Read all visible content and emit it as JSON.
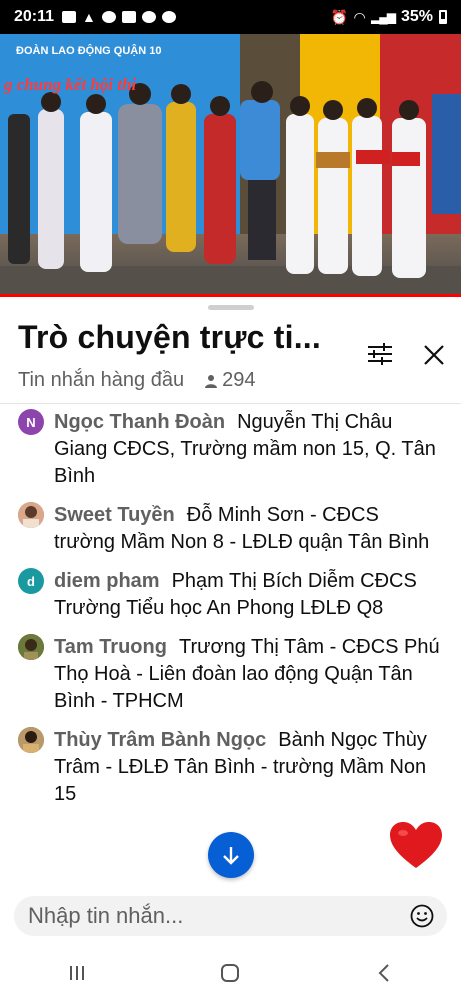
{
  "status_bar": {
    "time": "20:11",
    "battery": "35%"
  },
  "video": {
    "banner_line1": "ĐOÀN LAO ĐỘNG QUẬN 10",
    "banner_line2": "g chung kết hội thi"
  },
  "chat": {
    "title": "Trò chuyện trực ti...",
    "mode": "Tin nhắn hàng đầu",
    "viewer_count": "294",
    "input_placeholder": "Nhập tin nhắn...",
    "messages": [
      {
        "avatar_letter": "N",
        "avatar_color": "#8e44ad",
        "author": "Ngọc Thanh Đoàn",
        "text": "Nguyễn Thị Châu Giang CĐCS, Trường mầm non 15, Q. Tân Bình"
      },
      {
        "avatar_letter": "",
        "avatar_color": "#c58a6b",
        "author": "Sweet Tuyền",
        "text": "Đỗ Minh Sơn - CĐCS trường Mầm Non 8 - LĐLĐ quận Tân Bình"
      },
      {
        "avatar_letter": "d",
        "avatar_color": "#1a9aa0",
        "author": "diem pham",
        "text": "Phạm Thị Bích Diễm CĐCS Trường Tiểu học An Phong LĐLĐ Q8"
      },
      {
        "avatar_letter": "",
        "avatar_color": "#5a6b3a",
        "author": "Tam Truong",
        "text": "Trương Thị Tâm - CĐCS Phú Thọ Hoà - Liên đoàn lao động Quận Tân Bình - TPHCM"
      },
      {
        "avatar_letter": "",
        "avatar_color": "#8a6a4a",
        "author": "Thùy Trâm Bành Ngọc",
        "text": "Bành Ngọc Thùy Trâm - LĐLĐ Tân Bình - trường Mầm Non 15"
      }
    ]
  },
  "colors": {
    "accent": "#065fd4",
    "progress": "#ff0000",
    "heart": "#e0191e"
  },
  "icons": {
    "filter": "tune-icon",
    "close": "close-icon",
    "viewers": "person-icon",
    "scroll": "arrow-down-icon",
    "reaction": "heart-icon",
    "emoji": "emoji-icon"
  }
}
